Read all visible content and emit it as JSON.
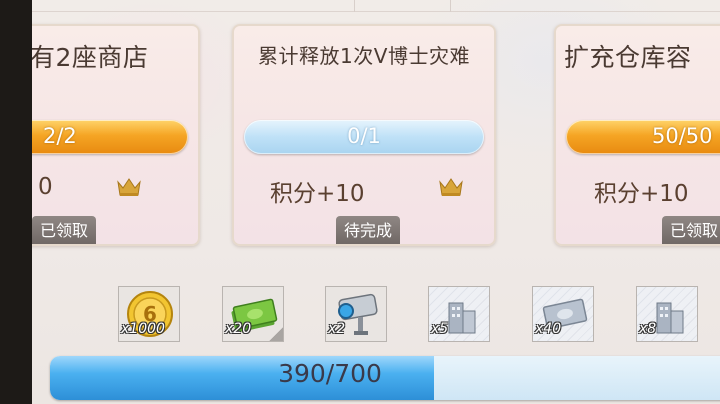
{
  "cards": [
    {
      "title": "有2座商店",
      "progress_text": "2/2",
      "progress_fraction": 1.0,
      "points": "0",
      "status": "已领取",
      "bar_color": "#f5a524"
    },
    {
      "title": "累计释放1次V博士灾难",
      "progress_text": "0/1",
      "progress_fraction": 0.0,
      "points": "积分+10",
      "status": "待完成",
      "bar_color": "#bfe1f7"
    },
    {
      "title": "扩充仓库容",
      "progress_text": "50/50",
      "progress_fraction": 1.0,
      "points": "积分+10",
      "status": "已领取",
      "bar_color": "#f5a524"
    }
  ],
  "rewards": [
    {
      "icon": "gold-coin-icon",
      "qty": "x1000"
    },
    {
      "icon": "cash-stack-icon",
      "qty": "x20"
    },
    {
      "icon": "security-camera-icon",
      "qty": "x2"
    },
    {
      "icon": "building-icon",
      "qty": "x5"
    },
    {
      "icon": "cash-stack-icon",
      "qty": "x40"
    },
    {
      "icon": "building-icon",
      "qty": "x8"
    }
  ],
  "total_progress": {
    "text": "390/700",
    "value": 390,
    "max": 700
  },
  "colors": {
    "orange_bar": "#f5a524",
    "blue_bar": "#4ab0f0",
    "status_badge": "#7a7370"
  }
}
